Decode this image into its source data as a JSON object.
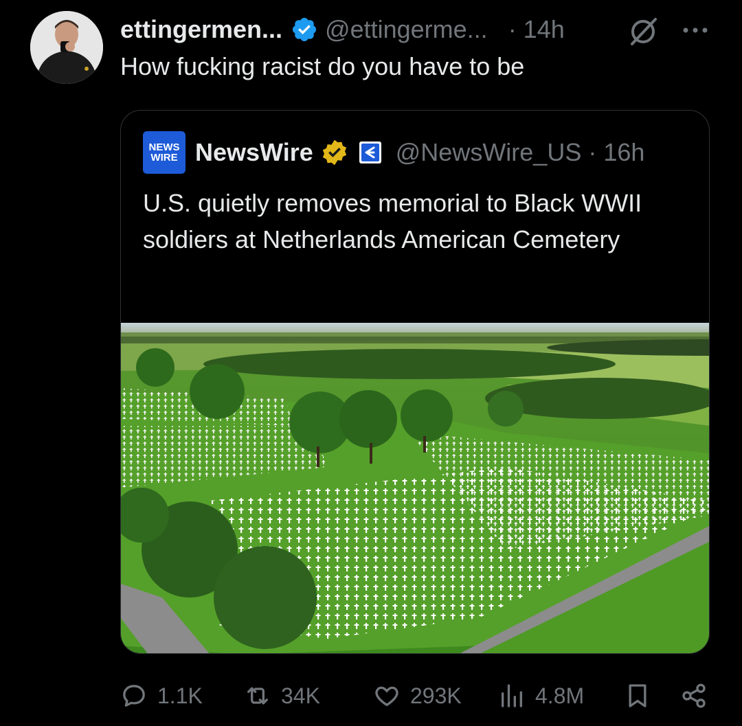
{
  "tweet": {
    "display_name": "ettingermen...",
    "handle": "@ettingerme...",
    "time": "· 14h",
    "text": "How fucking racist do you have to be"
  },
  "quoted": {
    "logo_line1": "NEWS",
    "logo_line2": "WIRE",
    "display_name": "NewsWire",
    "handle_time": "@NewsWire_US · 16h",
    "text": "U.S. quietly removes memorial to Black WWII soldiers at Netherlands American Cemetery"
  },
  "actions": {
    "replies": "1.1K",
    "reposts": "34K",
    "likes": "293K",
    "views": "4.8M"
  },
  "colors": {
    "background": "#000000",
    "text": "#e7e9ea",
    "muted": "#71767b",
    "verified_blue": "#1d9bf0",
    "verified_gold": "#e2b719",
    "border": "#2f3336"
  },
  "icons": [
    "verified-badge-icon",
    "grok-icon",
    "more-icon",
    "gold-badge-icon",
    "affiliate-badge-icon",
    "reply-icon",
    "repost-icon",
    "like-icon",
    "views-icon",
    "bookmark-icon",
    "share-icon"
  ]
}
